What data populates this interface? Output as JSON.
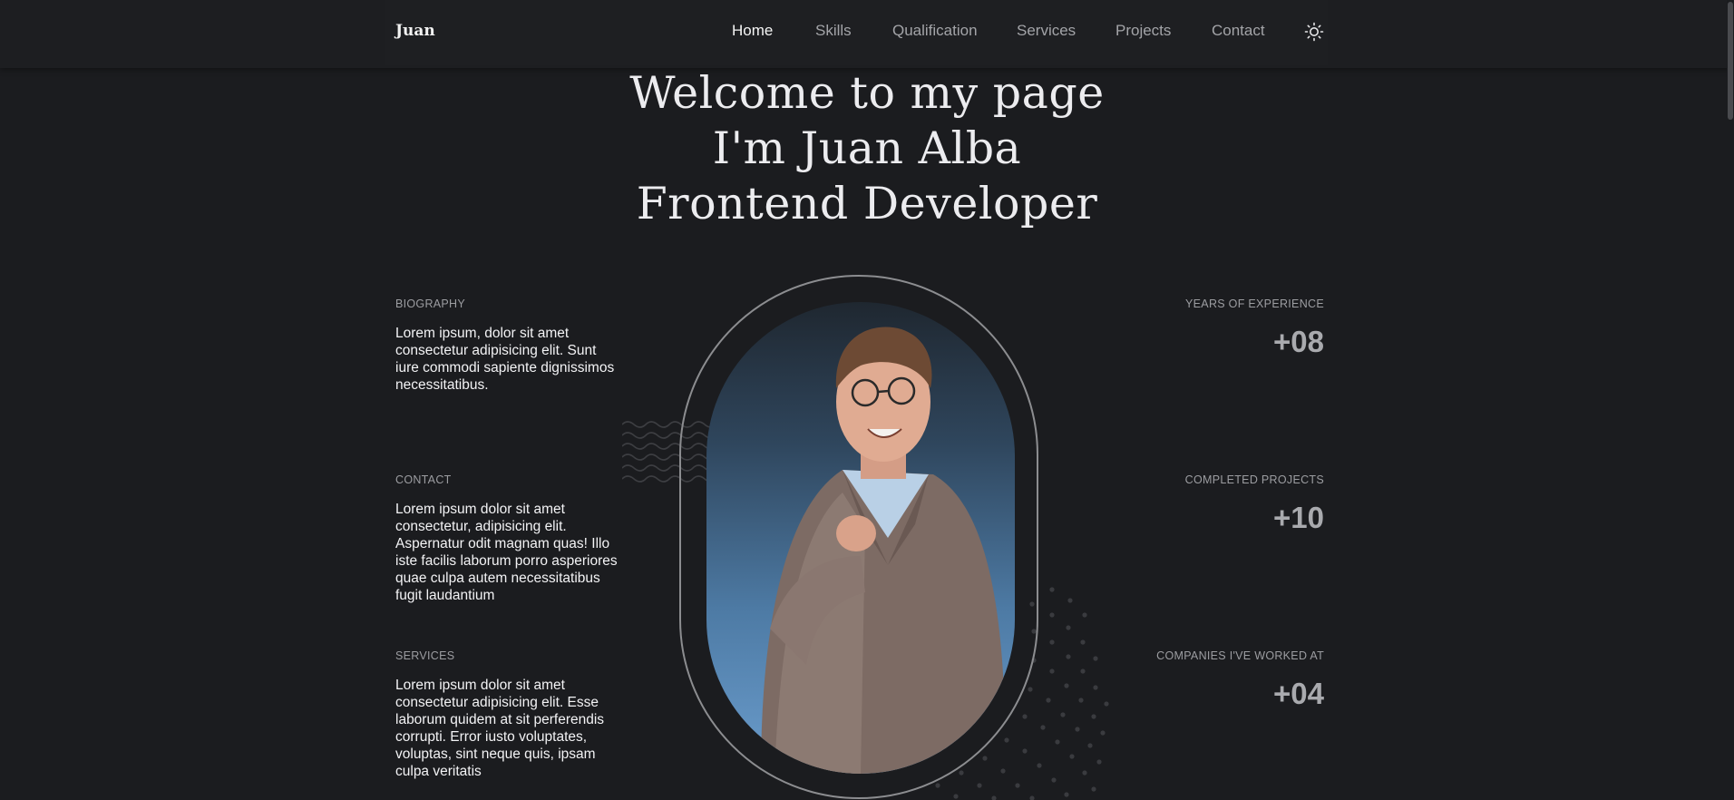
{
  "header": {
    "logo": "Juan",
    "nav": [
      {
        "label": "Home",
        "active": true
      },
      {
        "label": "Skills",
        "active": false
      },
      {
        "label": "Qualification",
        "active": false
      },
      {
        "label": "Services",
        "active": false
      },
      {
        "label": "Projects",
        "active": false
      },
      {
        "label": "Contact",
        "active": false
      }
    ],
    "theme_toggle_icon": "sun-icon"
  },
  "hero": {
    "line1": "Welcome to my page",
    "line2": "I'm Juan Alba",
    "line3": "Frontend Developer"
  },
  "info": [
    {
      "label": "BIOGRAPHY",
      "text": "Lorem ipsum, dolor sit amet consectetur adipisicing elit. Sunt iure commodi sapiente dignissimos necessitatibus."
    },
    {
      "label": "CONTACT",
      "text": "Lorem ipsum dolor sit amet consectetur, adipisicing elit. Aspernatur odit magnam quas! Illo iste facilis laborum porro asperiores quae culpa autem necessitatibus fugit laudantium"
    },
    {
      "label": "SERVICES",
      "text": "Lorem ipsum dolor sit amet consectetur adipisicing elit. Esse laborum quidem at sit perferendis corrupti. Error iusto voluptates, voluptas, sint neque quis, ipsam culpa veritatis"
    }
  ],
  "stats": [
    {
      "label": "YEARS OF EXPERIENCE",
      "value": "+08"
    },
    {
      "label": "COMPLETED PROJECTS",
      "value": "+10"
    },
    {
      "label": "COMPANIES I'VE WORKED AT",
      "value": "+04"
    }
  ],
  "colors": {
    "background": "#1b1c1f",
    "text_primary": "#f3f3f5",
    "text_muted": "#9c9da1",
    "stat_value": "#a9aaae"
  }
}
